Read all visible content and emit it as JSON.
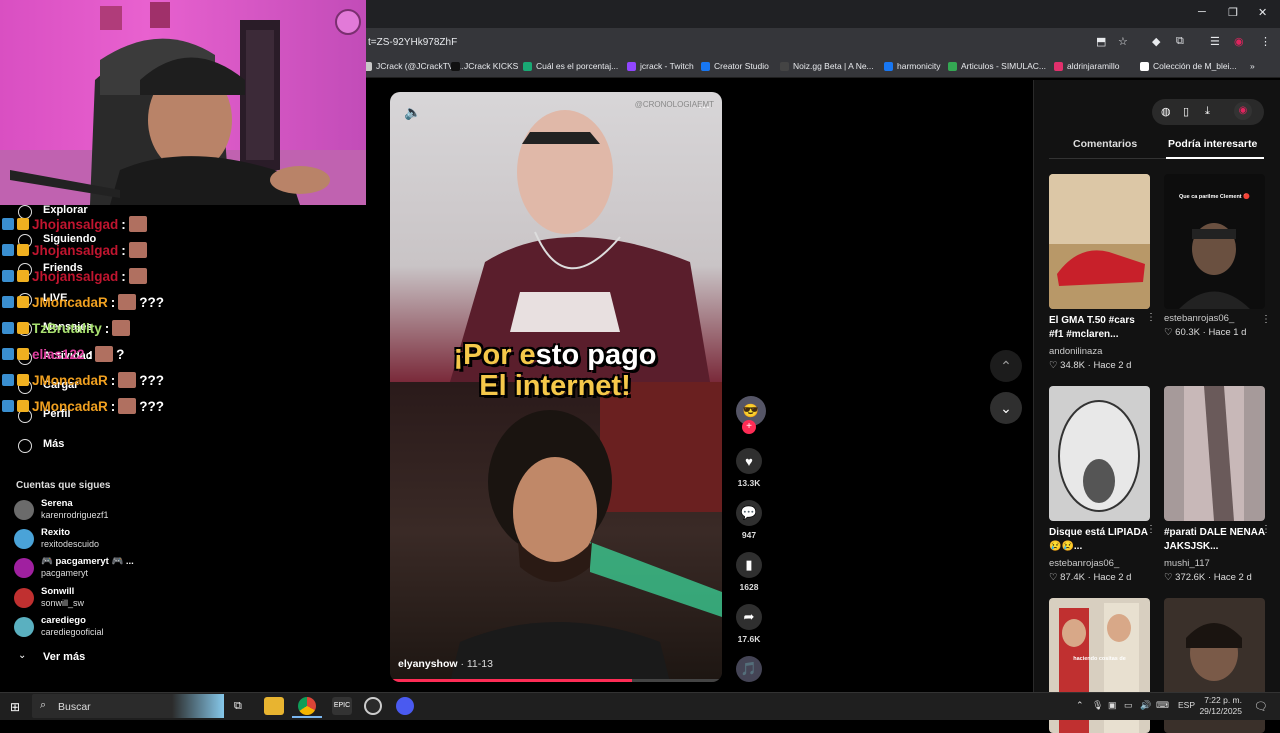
{
  "browser": {
    "url_fragment": "t=ZS-92YHk978ZhF",
    "bookmarks": [
      {
        "label": "JCrack (@JCrackTV)...",
        "color": "#c8c8c8"
      },
      {
        "label": "JCrack KICKS",
        "color": "#111111"
      },
      {
        "label": "Cuál es el porcentaj...",
        "color": "#19a974"
      },
      {
        "label": "jcrack - Twitch",
        "color": "#9146ff"
      },
      {
        "label": "Creator Studio",
        "color": "#1877f2"
      },
      {
        "label": "Noiz.gg Beta | A Ne...",
        "color": "#444444"
      },
      {
        "label": "harmonicity",
        "color": "#1877f2"
      },
      {
        "label": "Articulos - SIMULAC...",
        "color": "#34a853"
      },
      {
        "label": "aldrinjaramillo",
        "color": "#e1306c"
      },
      {
        "label": "Colección de M_blei...",
        "color": "#ffffff"
      }
    ],
    "more_bookmarks": "»"
  },
  "sidebar": {
    "nav": [
      {
        "label": "Explorar",
        "icon": "compass-icon"
      },
      {
        "label": "Siguiendo",
        "icon": "following-icon"
      },
      {
        "label": "Friends",
        "icon": "friends-icon"
      },
      {
        "label": "LIVE",
        "icon": "live-icon"
      },
      {
        "label": "Mensajes",
        "icon": "messages-icon"
      },
      {
        "label": "Actividad",
        "icon": "bell-icon"
      },
      {
        "label": "Cargar",
        "icon": "upload-icon"
      },
      {
        "label": "Perfil",
        "icon": "profile-icon"
      },
      {
        "label": "Más",
        "icon": "more-icon"
      }
    ],
    "following_heading": "Cuentas que sigues",
    "accounts": [
      {
        "name": "Serena",
        "handle": "karenrodriguezf1",
        "color": "#6b6b6b"
      },
      {
        "name": "Rexito",
        "handle": "rexitodescuido",
        "color": "#4aa3d8"
      },
      {
        "name": "🎮 pacgameryt 🎮 ...",
        "handle": "pacgameryt",
        "color": "#a020a0"
      },
      {
        "name": "Sonwill",
        "handle": "sonwill_sw",
        "color": "#c03030"
      },
      {
        "name": "carediego",
        "handle": "carediegooficial",
        "color": "#5ab0c0"
      }
    ],
    "see_more": "Ver más"
  },
  "chat": [
    {
      "user": "Jhojansalgad",
      "sep": ":",
      "msg": "",
      "color": "#c0152f"
    },
    {
      "user": "Jhojansalgad",
      "sep": ":",
      "msg": "",
      "color": "#c0152f"
    },
    {
      "user": "Jhojansalgad",
      "sep": ":",
      "msg": "",
      "color": "#c0152f"
    },
    {
      "user": "JMoncadaR",
      "sep": ":",
      "msg": "???",
      "color": "#f0a020"
    },
    {
      "user": "TzBrutality",
      "sep": ":",
      "msg": "",
      "color": "#a8e070"
    },
    {
      "user": "elias122",
      "sep": ":",
      "msg": "?",
      "color": "#e040a0"
    },
    {
      "user": "JMoncadaR",
      "sep": ":",
      "msg": "???",
      "color": "#f0a020"
    },
    {
      "user": "JMoncadaR",
      "sep": ":",
      "msg": "???",
      "color": "#f0a020"
    }
  ],
  "video": {
    "caption_highlight": "¡Por e",
    "caption_rest": "sto pago",
    "caption_line2": "El internet!",
    "author": "elyanyshow",
    "date": " · 11-13",
    "progress_fraction": 0.73,
    "watermark": "@CRONOLOGIAEMT",
    "volume_icon": "volume-icon"
  },
  "actions": {
    "likes": "13.3K",
    "comments": "947",
    "saves": "1628",
    "shares": "17.6K"
  },
  "right_panel": {
    "tabs": [
      "Comentarios",
      "Podría interesarte"
    ],
    "active_tab": 1,
    "cards": [
      {
        "title": "El GMA T.50 #cars #f1 #mclaren...",
        "author": "andonilinaza",
        "likes": "34.8K",
        "time": "Hace 2 d",
        "thumb_color": "#c9a678"
      },
      {
        "title": "",
        "author": "estebanrojas06_",
        "likes": "60.3K",
        "time": "Hace 1 d",
        "thumb_color": "#0d0d0d",
        "overlay_text": "Que ca parilme Clement 🔴"
      },
      {
        "title": "Disque está LIPIADA 😢😢...",
        "author": "estebanrojas06_",
        "likes": "87.4K",
        "time": "Hace 2 d",
        "thumb_color": "#cfcfcf"
      },
      {
        "title": "#parati DALE NENAA JAKSJSK...",
        "author": "mushi_117",
        "likes": "372.6K",
        "time": "Hace 2 d",
        "thumb_color": "#a69a9a"
      },
      {
        "title": "",
        "author": "",
        "likes": "",
        "time": "",
        "thumb_color": "#d8cfc0",
        "overlay_text": "haciendo cositas de"
      },
      {
        "title": "",
        "author": "",
        "likes": "",
        "time": "",
        "thumb_color": "#3a302a"
      }
    ]
  },
  "taskbar": {
    "search_label": "Buscar",
    "lang": "ESP",
    "time": "7:22 p. m.",
    "date": "29/12/2025"
  }
}
